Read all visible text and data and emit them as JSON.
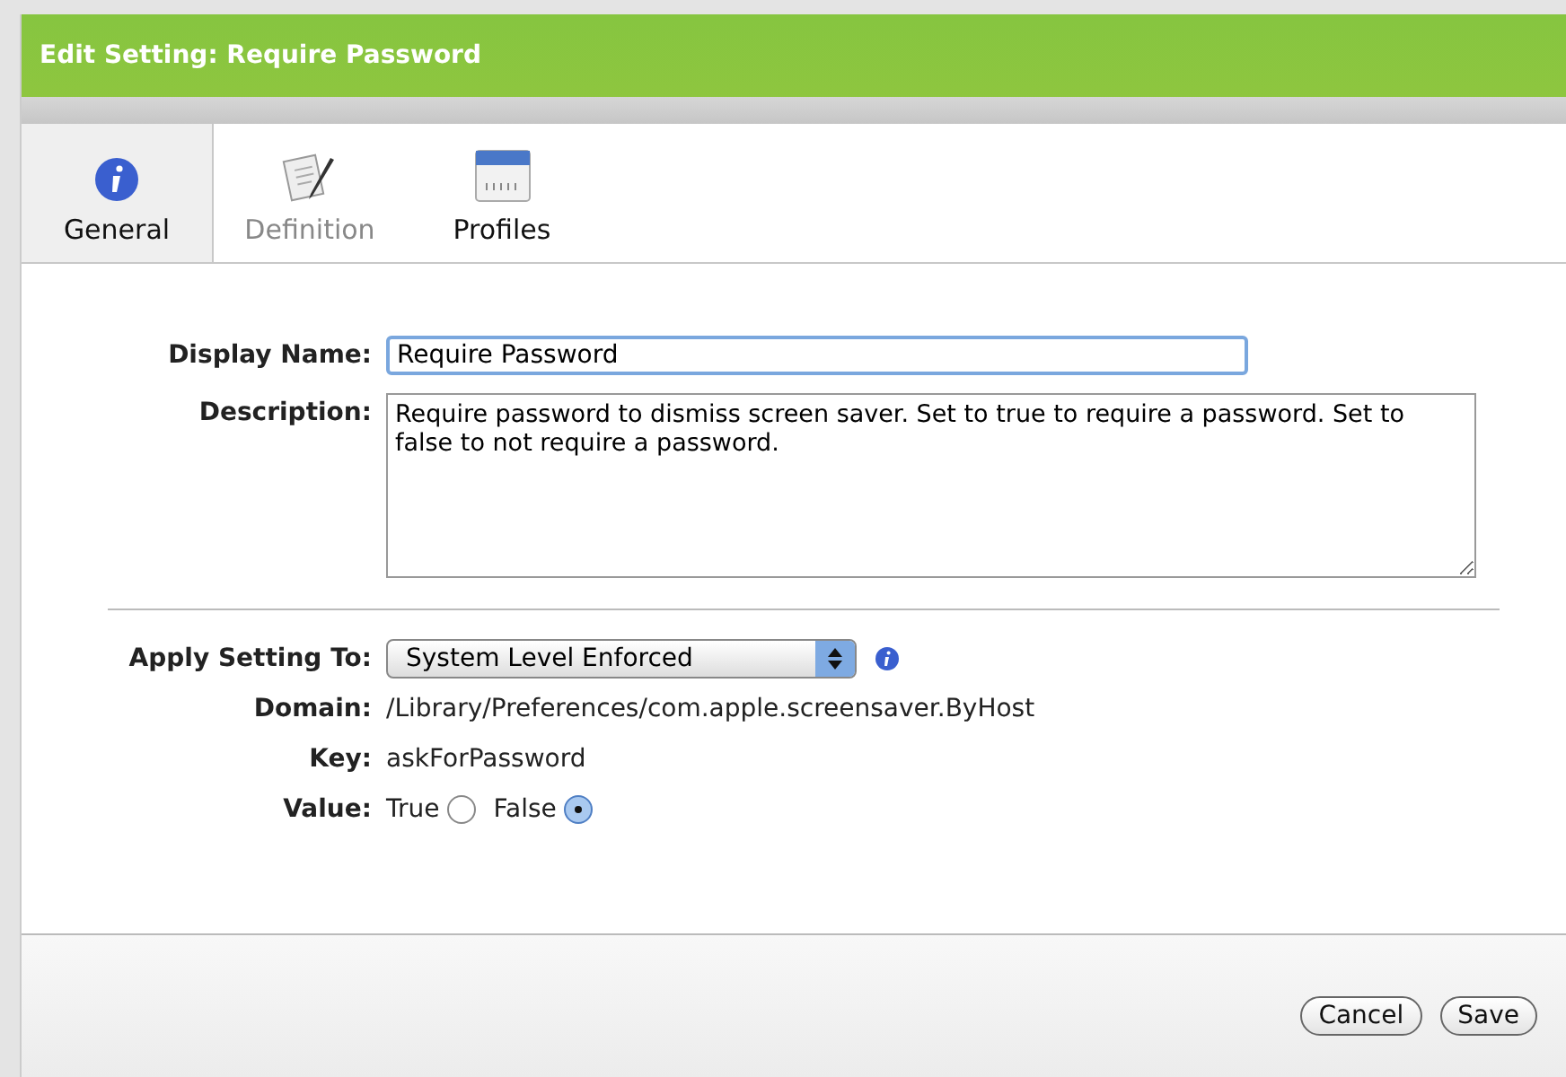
{
  "window": {
    "title": "Edit Setting: Require Password"
  },
  "tabs": [
    {
      "label": "General",
      "selected": true,
      "disabled": false
    },
    {
      "label": "Definition",
      "selected": false,
      "disabled": true
    },
    {
      "label": "Profiles",
      "selected": false,
      "disabled": false
    }
  ],
  "form": {
    "display_name_label": "Display Name:",
    "display_name_value": "Require Password",
    "description_label": "Description:",
    "description_value": "Require password to dismiss screen saver. Set to true to require a password. Set to false to not require a password.",
    "apply_label": "Apply Setting To:",
    "apply_value": "System Level Enforced",
    "domain_label": "Domain:",
    "domain_value": "/Library/Preferences/com.apple.screensaver.ByHost",
    "key_label": "Key:",
    "key_value": "askForPassword",
    "value_label": "Value:",
    "value_options": [
      {
        "label": "True",
        "selected": false
      },
      {
        "label": "False",
        "selected": true
      }
    ]
  },
  "buttons": [
    "Cancel",
    "Save"
  ]
}
